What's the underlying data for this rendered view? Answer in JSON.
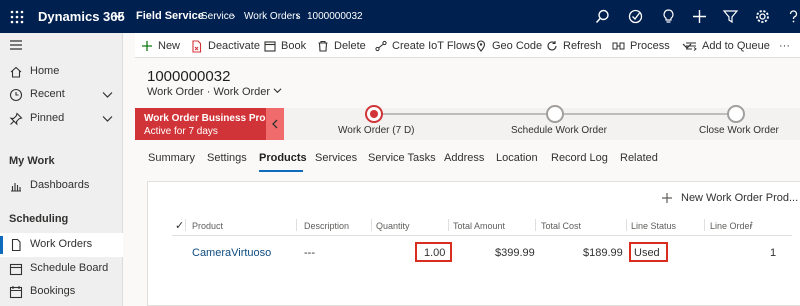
{
  "topbar": {
    "app_name": "Dynamics 365",
    "area": "Field Service",
    "breadcrumbs": [
      "Service",
      "Work Orders",
      "1000000032"
    ],
    "icons": [
      "search-icon",
      "target-icon",
      "lightbulb-icon",
      "plus-icon",
      "filter-icon",
      "gear-icon",
      "help-icon"
    ]
  },
  "sidebar": {
    "home": "Home",
    "recent": "Recent",
    "pinned": "Pinned",
    "section_my_work": "My Work",
    "dashboards": "Dashboards",
    "section_scheduling": "Scheduling",
    "work_orders": "Work Orders",
    "schedule_board": "Schedule Board",
    "bookings": "Bookings"
  },
  "commands": {
    "new": "New",
    "deactivate": "Deactivate",
    "book": "Book",
    "delete": "Delete",
    "create_iot_flows": "Create IoT Flows",
    "geo_code": "Geo Code",
    "refresh": "Refresh",
    "process": "Process",
    "add_to_queue": "Add to Queue",
    "more": "···"
  },
  "record": {
    "title": "1000000032",
    "entity": "Work Order",
    "form": "Work Order"
  },
  "bpf": {
    "active_process": "Work Order Business Pro...",
    "active_for": "Active for 7 days",
    "stages": [
      {
        "label": "Work Order  (7 D)"
      },
      {
        "label": "Schedule Work Order"
      },
      {
        "label": "Close Work Order"
      }
    ]
  },
  "tabs": [
    "Summary",
    "Settings",
    "Products",
    "Services",
    "Service Tasks",
    "Address",
    "Location",
    "Record Log",
    "Related"
  ],
  "products": {
    "new_button": "New Work Order Prod...",
    "columns": [
      "Product",
      "Description",
      "Quantity",
      "Total Amount",
      "Total Cost",
      "Line Status",
      "Line Order"
    ],
    "sort_indicator": "↑",
    "check_icon": "✓",
    "row": {
      "product": "CameraVirtuoso",
      "description": "---",
      "quantity": "1.00",
      "total_amount": "$399.99",
      "total_cost": "$189.99",
      "line_status": "Used",
      "line_order": "1"
    }
  },
  "colors": {
    "topbar": "#002050",
    "accent": "#0f6cbd",
    "bpf_active": "#d13438",
    "highlight": "#d92d20"
  }
}
